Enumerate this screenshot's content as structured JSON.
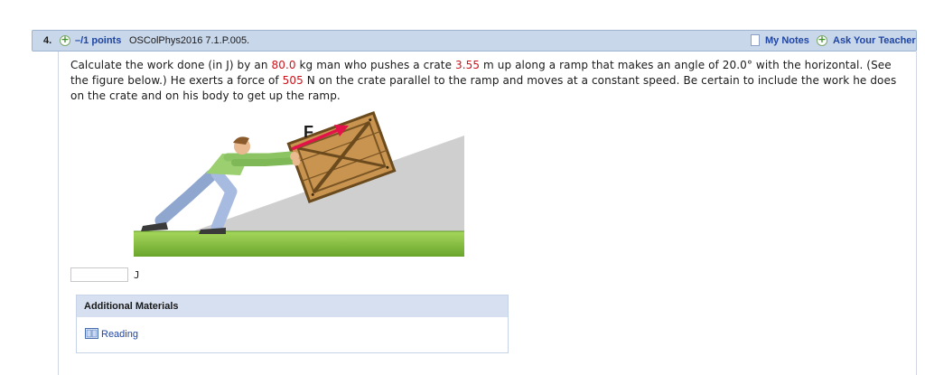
{
  "question": {
    "number": "4.",
    "points": "–/1 points",
    "problem_id": "OSColPhys2016 7.1.P.005.",
    "my_notes": "My Notes",
    "ask_teacher": "Ask Your Teacher",
    "text": {
      "p1": "Calculate the work done (in J) by an ",
      "mass": "80.0",
      "p2": " kg man who pushes a crate ",
      "distance": "3.55",
      "p3": " m up along a ramp that makes an angle of 20.0° with the horizontal. (See the figure below.) He exerts a force of ",
      "force": "505",
      "p4": " N on the crate parallel to the ramp and moves at a constant speed. Be certain to include the work he does on the crate and on his body to get up the ramp."
    },
    "figure": {
      "force_label": "F"
    },
    "answer": {
      "value": "",
      "unit": "J"
    }
  },
  "additional_materials": {
    "title": "Additional Materials",
    "items": [
      {
        "label": "Reading",
        "icon": "book-icon"
      }
    ]
  },
  "colors": {
    "header_bg": "#c9d7ea",
    "link": "#1f46a3",
    "highlight": "#d0121b",
    "ramp": "#cfcfcf",
    "ground": "#8cc63f",
    "arrow": "#e3134a"
  }
}
